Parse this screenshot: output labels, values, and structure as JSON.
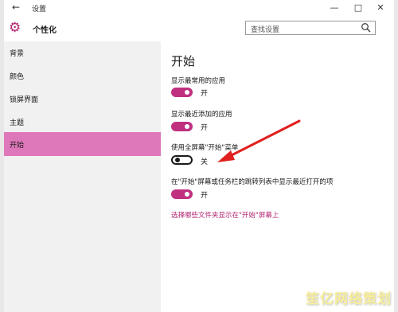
{
  "titlebar": {
    "back_icon": "back-arrow-icon",
    "title": "设置",
    "minimize": "—",
    "maximize": "□",
    "close": "✕"
  },
  "header": {
    "icon": "gear-icon",
    "title": "个性化",
    "search_placeholder": "查找设置"
  },
  "sidebar": {
    "items": [
      {
        "label": "背景",
        "active": false
      },
      {
        "label": "颜色",
        "active": false
      },
      {
        "label": "锁屏界面",
        "active": false
      },
      {
        "label": "主题",
        "active": false
      },
      {
        "label": "开始",
        "active": true
      }
    ]
  },
  "content": {
    "title": "开始",
    "settings": [
      {
        "label": "显示最常用的应用",
        "state": "开",
        "on": true
      },
      {
        "label": "显示最近添加的应用",
        "state": "开",
        "on": true
      },
      {
        "label": "使用全屏幕\"开始\"菜单",
        "state": "关",
        "on": false
      },
      {
        "label": "在\"开始\"屏幕或任务栏的跳转列表中显示最近打开的项",
        "state": "开",
        "on": true
      }
    ],
    "link": "选择哪些文件夹显示在\"开始\"屏幕上"
  },
  "colors": {
    "accent": "#c0307f",
    "sidebar_active": "#df77bb",
    "annotation_arrow": "#e0201e"
  },
  "watermark": "笙亿网络策划"
}
